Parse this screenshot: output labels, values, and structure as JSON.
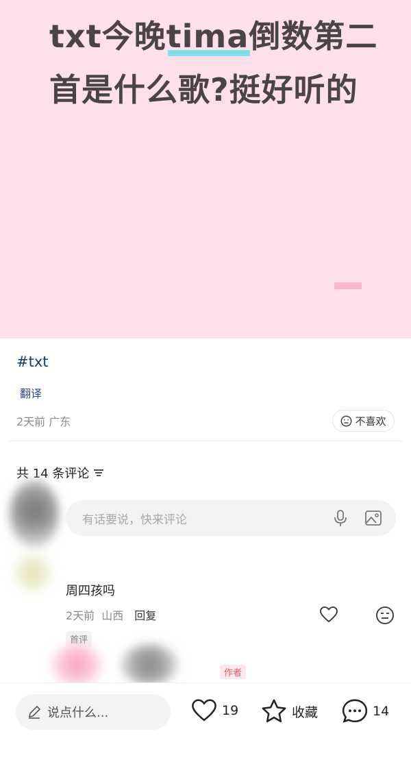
{
  "post": {
    "title_part1": "txt今晚",
    "title_highlight": "tima",
    "title_part2": "倒数第二首是什么歌?挺好听的",
    "hashtag": "#txt",
    "translate_label": "翻译",
    "meta": "2天前 广东",
    "dislike_label": "不喜欢"
  },
  "comments_header": {
    "count_label": "共 14 条评论"
  },
  "comment_input": {
    "placeholder": "有话要说，快来评论"
  },
  "comments": [
    {
      "text": "周四孩吗",
      "time": "2天前",
      "location": "山西",
      "reply_label": "回复",
      "badge": "首评"
    }
  ],
  "reply_preview": {
    "author_badge": "作者"
  },
  "bottom_bar": {
    "say_placeholder": "说点什么...",
    "likes": "19",
    "favorite_label": "收藏",
    "comments": "14"
  },
  "colors": {
    "hero_background": "#fee0e8",
    "highlight": "#7fe0ea",
    "link_blue": "#1b3a66"
  }
}
